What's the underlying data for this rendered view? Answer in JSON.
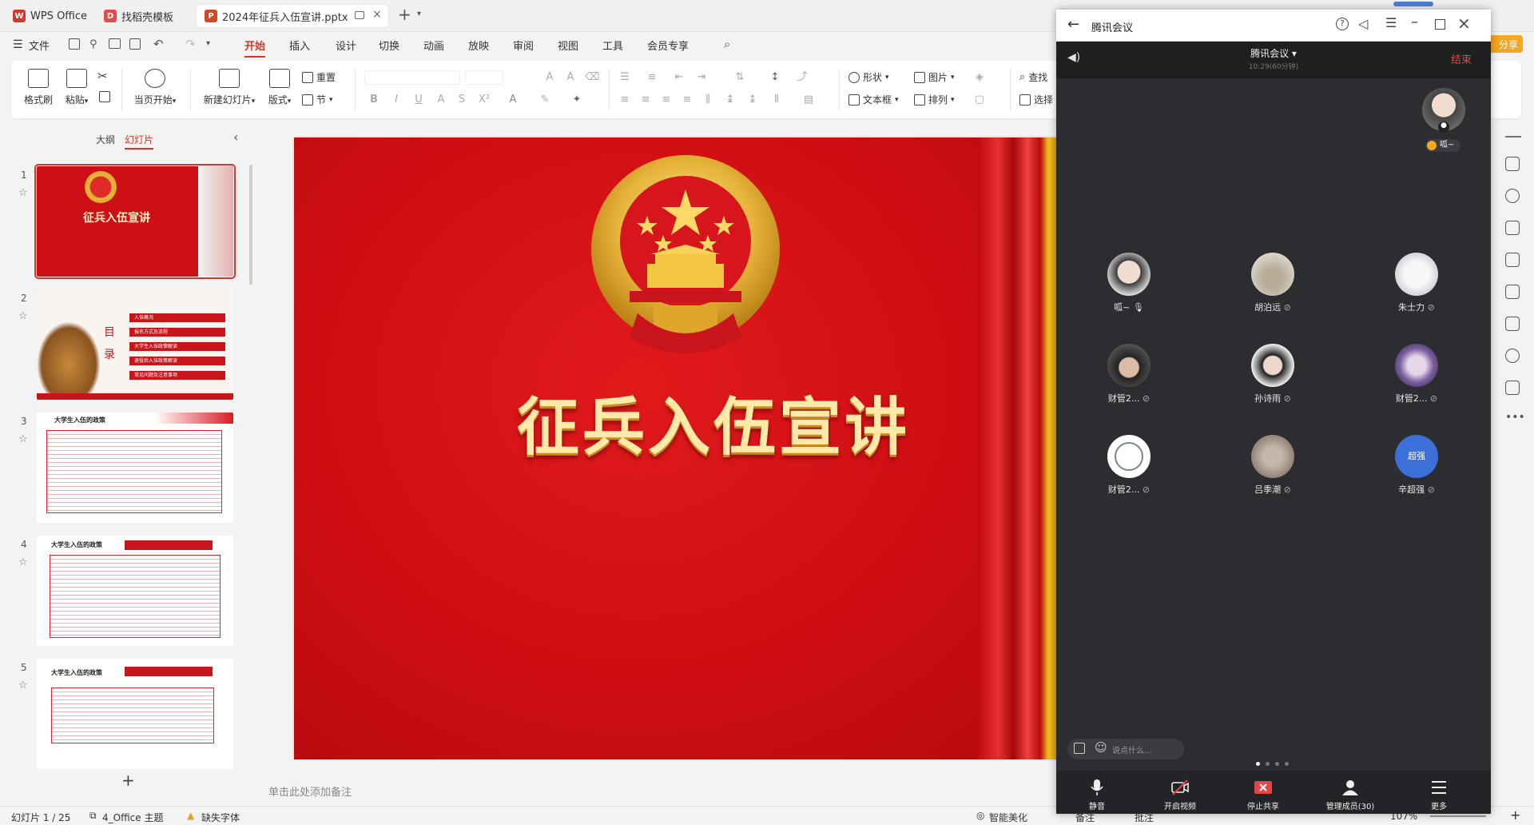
{
  "tabs": [
    {
      "label": "WPS Office",
      "icon": "wps-logo-icon",
      "color": "#d4382c"
    },
    {
      "label": "找稻壳模板",
      "icon": "docer-icon",
      "color": "#e8494c"
    },
    {
      "label": "2024年征兵入伍宣讲.pptx",
      "icon": "ppt-file-icon",
      "color": "#d24726"
    }
  ],
  "menu": {
    "file": "文件",
    "items": [
      "开始",
      "插入",
      "设计",
      "切换",
      "动画",
      "放映",
      "审阅",
      "视图",
      "工具",
      "会员专享"
    ],
    "active": "开始"
  },
  "ribbon": {
    "format_painter": "格式刷",
    "paste": "粘贴",
    "play_from_current": "当页开始",
    "new_slide": "新建幻灯片",
    "layout": "版式",
    "reset": "重置",
    "section": "节",
    "shape": "形状",
    "picture": "图片",
    "textbox": "文本框",
    "arrange": "排列",
    "find": "查找",
    "select": "选择"
  },
  "panel": {
    "outline_tab": "大纲",
    "slides_tab": "幻灯片",
    "thumbs": [
      {
        "num": "1",
        "title": "征兵入伍宣讲"
      },
      {
        "num": "2",
        "title": "目录",
        "items": [
          "入伍概况",
          "报名方式及流程",
          "大学生入伍政策解读",
          "退役后入伍政策解读",
          "常见问题及注意事项"
        ]
      },
      {
        "num": "3",
        "title": "大学生入伍的政策"
      },
      {
        "num": "4",
        "title": "大学生入伍的政策"
      },
      {
        "num": "5",
        "title": "大学生入伍的政策"
      }
    ],
    "add": "+"
  },
  "slide": {
    "title": "征兵入伍宣讲"
  },
  "notes_placeholder": "单击此处添加备注",
  "status": {
    "slide_counter": "幻灯片 1 / 25",
    "theme": "4_Office 主题",
    "missing_font": "缺失字体",
    "smart_beautify": "智能美化",
    "notes": "备注",
    "comments": "批注",
    "zoom": "107%"
  },
  "meeting": {
    "app_title": "腾讯会议",
    "meeting_name": "腾讯会议",
    "duration": "10:29(60分钟)",
    "end_label": "结束",
    "share_label": "分享",
    "speaker_name": "呱~",
    "chat_placeholder": "说点什么...",
    "participants": [
      {
        "name": "呱~",
        "avatar": "photo-boy",
        "mic": "on"
      },
      {
        "name": "胡泊远",
        "avatar": "photo-stone",
        "mic": "muted"
      },
      {
        "name": "朱士力",
        "avatar": "sketch-girl",
        "mic": "muted"
      },
      {
        "name": "财管2...",
        "avatar": "photo-boy-dark",
        "mic": "muted"
      },
      {
        "name": "孙诗雨",
        "avatar": "photo-boy-white",
        "mic": "muted"
      },
      {
        "name": "财管2...",
        "avatar": "photo-girl-purple",
        "mic": "muted"
      },
      {
        "name": "财管2...",
        "avatar": "school-logo",
        "mic": "muted"
      },
      {
        "name": "吕季潮",
        "avatar": "photo-cat",
        "mic": "muted"
      },
      {
        "name": "辛超强",
        "avatar": "text-avatar",
        "avatar_text": "超强",
        "mic": "muted"
      }
    ],
    "toolbar": [
      {
        "label": "静音",
        "icon": "microphone-icon"
      },
      {
        "label": "开启视频",
        "icon": "camera-off-icon"
      },
      {
        "label": "停止共享",
        "icon": "stop-share-icon"
      },
      {
        "label": "管理成员(30)",
        "icon": "members-icon"
      },
      {
        "label": "更多",
        "icon": "more-icon"
      }
    ]
  },
  "colors": {
    "accent": "#d4382c",
    "slide_red": "#d0141b",
    "gold": "#f2c44b",
    "meeting_bg": "#2b2d30",
    "meeting_end": "#e54545",
    "avatar_blue": "#3d6fd9"
  }
}
